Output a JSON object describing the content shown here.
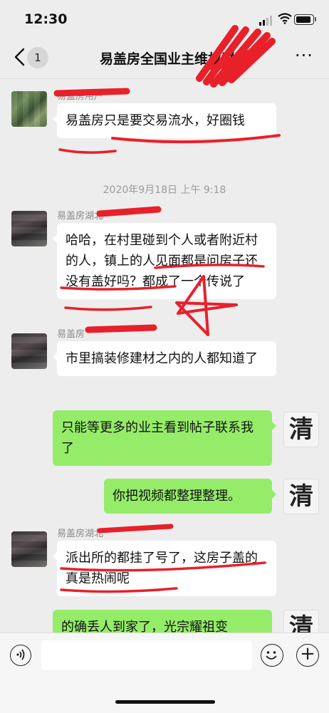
{
  "status_bar": {
    "time": "12:30"
  },
  "nav": {
    "back_badge": "1",
    "title": "易盖房全国业主维权群",
    "more_label": "···"
  },
  "messages": [
    {
      "sender": "易盖房用户",
      "text": "易盖房只是要交易流水，好圈钱",
      "side": "left"
    },
    {
      "sender": "易盖房湖北",
      "text": "哈哈，在村里碰到个人或者附近村的人，镇上的人见面都是问房子还没有盖好吗？都成了一个传说了",
      "side": "left"
    },
    {
      "sender": "易盖房",
      "text": "市里搞装修建材之内的人都知道了",
      "side": "left"
    },
    {
      "text": "只能等更多的业主看到帖子联系我了",
      "side": "right",
      "avatar_char": "清"
    },
    {
      "text": "你把视频都整理整理。",
      "side": "right",
      "avatar_char": "清"
    },
    {
      "sender": "易盖房湖北",
      "text": "派出所的都挂了号了，这房子盖的真是热闹呢",
      "side": "left"
    },
    {
      "text": "的确丢人到家了，光宗耀祖变",
      "side": "right",
      "avatar_char": "清"
    }
  ],
  "timestamp": "2020年9月18日 上午 9:18",
  "colors": {
    "bubble_green": "#95ec69",
    "annotation_red": "#e8202a",
    "background": "#ededed"
  }
}
